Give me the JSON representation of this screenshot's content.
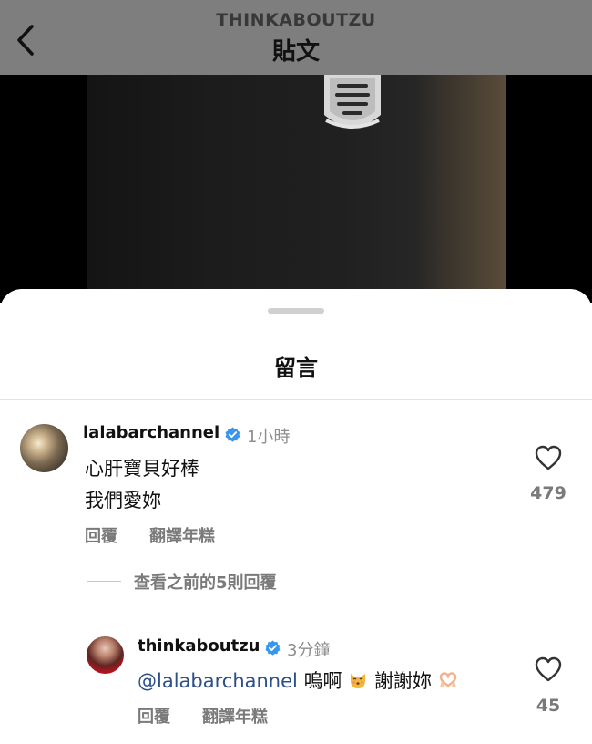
{
  "header": {
    "username": "THINKABOUTZU",
    "title": "貼文"
  },
  "sheet": {
    "title": "留言"
  },
  "comments": [
    {
      "username": "lalabarchannel",
      "time": "1小時",
      "lines": [
        "心肝寶貝好棒",
        "我們愛妳"
      ],
      "reply_label": "回覆",
      "translate_label": "翻譯年糕",
      "likes": "479"
    }
  ],
  "view_previous": "查看之前的5則回覆",
  "reply": {
    "username": "thinkaboutzu",
    "time": "3分鐘",
    "mention": "@lalabarchannel",
    "text_part1": "嗚啊",
    "text_part2": "謝謝妳",
    "reply_label": "回覆",
    "translate_label": "翻譯年糕",
    "likes": "45"
  },
  "colors": {
    "verified": "#3797f0",
    "mention": "#2b4f86",
    "secondary_text": "#7a7a7a"
  },
  "icons": {
    "back": "chevron-left-icon",
    "verified": "verified-badge-icon",
    "like": "heart-outline-icon"
  }
}
